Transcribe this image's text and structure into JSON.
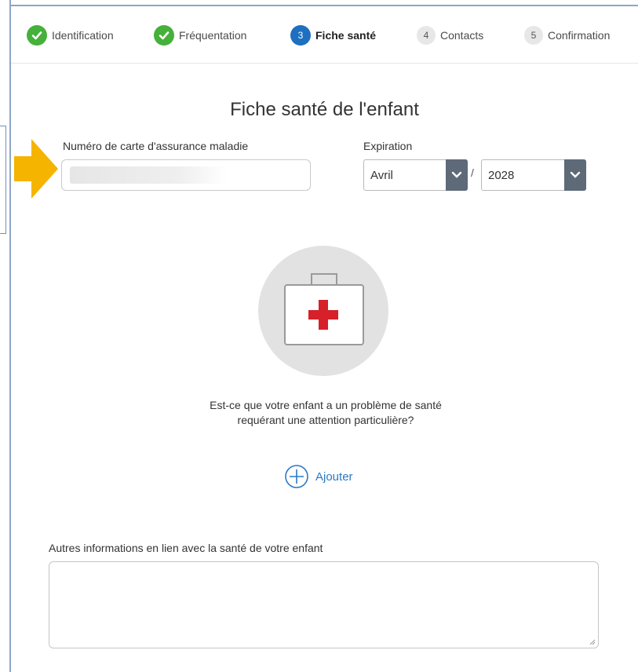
{
  "stepper": {
    "steps": [
      {
        "number": "",
        "label": "Identification",
        "state": "completed",
        "icon": "check-icon"
      },
      {
        "number": "",
        "label": "Fréquentation",
        "state": "completed",
        "icon": "check-icon"
      },
      {
        "number": "3",
        "label": "Fiche santé",
        "state": "active"
      },
      {
        "number": "4",
        "label": "Contacts",
        "state": "upcoming"
      },
      {
        "number": "5",
        "label": "Confirmation",
        "state": "upcoming"
      }
    ]
  },
  "page": {
    "title": "Fiche santé de l'enfant"
  },
  "form": {
    "card_label": "Numéro de carte d'assurance maladie",
    "card_value": "",
    "expiration_label": "Expiration",
    "month_selected": "Avril",
    "separator": "/",
    "year_selected": "2028",
    "question_line1": "Est-ce que votre enfant a un problème de santé",
    "question_line2": "requérant une attention particulière?",
    "add_label": "Ajouter",
    "other_label": "Autres informations en lien avec la santé de votre enfant",
    "other_value": ""
  },
  "icons": {
    "kit": "first-aid-kit-icon",
    "add": "plus-circle-icon",
    "caret": "chevron-down-icon",
    "pointer": "arrow-right-icon"
  },
  "colors": {
    "completed": "#45b03a",
    "active": "#1f6fc0",
    "link": "#2c78c4",
    "arrow": "#f5b400",
    "cross": "#d6202a"
  }
}
